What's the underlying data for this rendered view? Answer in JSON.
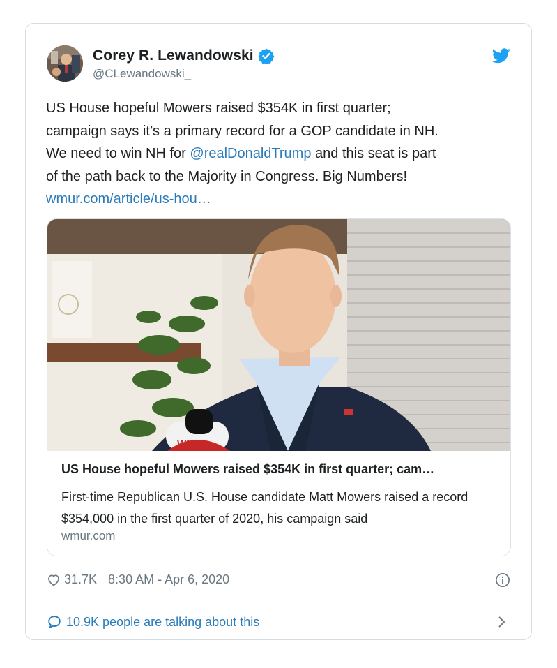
{
  "tweet": {
    "author_name": "Corey R. Lewandowski",
    "author_handle": "@CLewandowski_",
    "text_lines": [
      "US House hopeful Mowers raised $354K in first quarter;",
      "campaign says it’s a primary record for a GOP candidate in NH.",
      "We need to win NH for ",
      "@realDonaldTrump",
      " and this seat is part",
      "of the path back to the Majority in Congress.  Big Numbers!",
      "wmur.com/article/us-hou…"
    ],
    "card": {
      "title": "US House hopeful Mowers raised $354K in first quarter; cam…",
      "description": "First-time Republican U.S. House candidate Matt Mowers raised a record $354,000 in the first quarter of 2020, his campaign said",
      "domain": "wmur.com",
      "mic_logo_text": "WMU"
    },
    "likes": "31.7K",
    "timestamp": "8:30 AM - Apr 6, 2020",
    "talking": "10.9K people are talking about this"
  },
  "icons": {
    "verified": "verified-badge-icon",
    "bird": "twitter-bird-icon",
    "heart": "heart-icon",
    "info": "info-icon",
    "speech": "speech-bubble-icon",
    "chevron": "chevron-right-icon"
  },
  "colors": {
    "link": "#2b7bb9",
    "twitter_blue": "#1da1f2",
    "muted": "#697882",
    "text": "#1c2022",
    "border": "#d5dde3"
  }
}
